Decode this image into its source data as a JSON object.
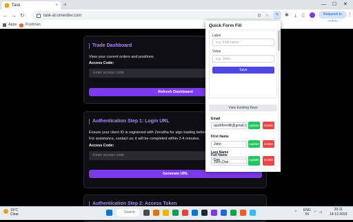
{
  "browser": {
    "tab_title": "Task",
    "tab_close": "×",
    "newtab": "+",
    "url": "task-ai.omerdev.com",
    "relaunch_label": "Relaunch to update",
    "bookmarks": [
      {
        "label": "Apps"
      },
      {
        "label": "Postman"
      }
    ]
  },
  "page": {
    "trade_card": {
      "title": "Trade Dashboard",
      "text": "View your current orders and positions",
      "label": "Access Code:",
      "placeholder": "Enter access code",
      "button": "Refresh Dashboard"
    },
    "auth1_card": {
      "title": "Authentication Step 1: Login URL",
      "text1": "Ensure your client ID is registered with Zerodha for algo trading before u",
      "text2": "For assistance, contact us; it will be completed within 2-4 minutes.",
      "label": "Access Code:",
      "placeholder": "Enter access code",
      "button": "Generate URL"
    },
    "auth2_card": {
      "title": "Authentication Step 2: Access Token"
    }
  },
  "popup": {
    "title": "Quick Form Fill",
    "label_field": "Label",
    "label_placeholder": "e.g. First name",
    "value_field": "Value",
    "value_placeholder": "e.g. John",
    "save": "Save",
    "view": "View Existing Keys",
    "update": "Update",
    "delete": "Delete",
    "entries": [
      {
        "label": "Email",
        "value": "quickformfill@gmail.com"
      },
      {
        "label": "First Name",
        "value": "John"
      },
      {
        "label": "Full Name",
        "value": "John Doe"
      },
      {
        "label": "Last Name",
        "value": "Doe"
      }
    ]
  },
  "taskbar": {
    "temp": "19°C",
    "condition": "Clear",
    "search": "Search",
    "lang1": "ENG",
    "lang2": "IN",
    "time": "20:11",
    "date": "14-12-2023"
  }
}
